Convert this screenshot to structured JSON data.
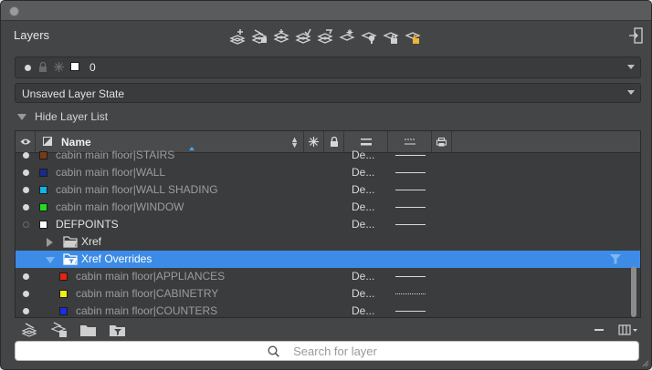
{
  "panel": {
    "title": "Layers"
  },
  "toolbar_icons": [
    "new-layer-icon",
    "new-layer-vp-frozen-icon",
    "layer-merge-icon",
    "layer-match-icon",
    "layer-previous-icon",
    "freeze-layer-icon",
    "turn-off-layer-icon",
    "lock-layer-icon",
    "unlock-layer-icon"
  ],
  "current_layer": {
    "name": "0",
    "color": "#ffffff"
  },
  "layer_state": {
    "value": "Unsaved Layer State"
  },
  "hide_list": {
    "label": "Hide Layer List"
  },
  "columns": {
    "name": "Name"
  },
  "rows": [
    {
      "kind": "layer",
      "style": "xref",
      "visible": true,
      "color": "#7a3a10",
      "name": "cabin main floor|STAIRS",
      "linetype": "De...",
      "line": "solid"
    },
    {
      "kind": "layer",
      "style": "xref",
      "visible": true,
      "color": "#1a2a8c",
      "name": "cabin main floor|WALL",
      "linetype": "De...",
      "line": "solid"
    },
    {
      "kind": "layer",
      "style": "xref",
      "visible": true,
      "color": "#11b3e8",
      "name": "cabin main floor|WALL SHADING",
      "linetype": "De...",
      "line": "solid"
    },
    {
      "kind": "layer",
      "style": "xref",
      "visible": true,
      "color": "#1fdc1f",
      "name": "cabin main floor|WINDOW",
      "linetype": "De...",
      "line": "solid"
    },
    {
      "kind": "layer",
      "style": "plain",
      "visible": false,
      "color": "#ffffff",
      "name": "DEFPOINTS",
      "linetype": "De...",
      "line": "solid"
    },
    {
      "kind": "group",
      "expanded": false,
      "name": "Xref"
    },
    {
      "kind": "group",
      "expanded": true,
      "selected": true,
      "name": "Xref Overrides"
    },
    {
      "kind": "layer",
      "style": "xref",
      "indent": true,
      "visible": true,
      "color": "#e8230f",
      "name": "cabin main floor|APPLIANCES",
      "linetype": "De...",
      "line": "solid"
    },
    {
      "kind": "layer",
      "style": "xref",
      "indent": true,
      "visible": true,
      "color": "#f2ee12",
      "name": "cabin main floor|CABINETRY",
      "linetype": "De...",
      "line": "dotted"
    },
    {
      "kind": "layer",
      "style": "xref",
      "indent": true,
      "visible": true,
      "color": "#1a2ee0",
      "name": "cabin main floor|COUNTERS",
      "linetype": "De...",
      "line": "solid"
    }
  ],
  "search": {
    "placeholder": "Search for layer"
  },
  "colors": {
    "selection": "#3c8ce7",
    "panel_bg": "#444546",
    "sort_indicator": "#3fa9f5"
  }
}
